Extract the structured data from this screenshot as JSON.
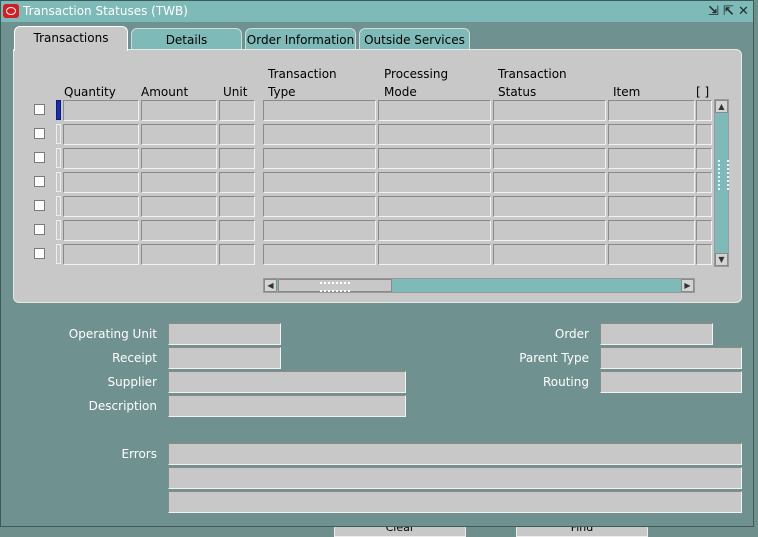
{
  "window": {
    "title": "Transaction Statuses (TWB)",
    "controls": {
      "minimize": "⇲",
      "maximize": "⇱",
      "close": "✕"
    }
  },
  "tabs": [
    {
      "label": "Transactions",
      "active": true
    },
    {
      "label": "Details",
      "active": false
    },
    {
      "label": "Order Information",
      "active": false
    },
    {
      "label": "Outside Services",
      "active": false
    }
  ],
  "grid": {
    "headers": {
      "quantity": "Quantity",
      "amount": "Amount",
      "unit": "Unit",
      "transaction_type": "Transaction Type",
      "processing_mode": "Processing Mode",
      "transaction_status": "Transaction Status",
      "item": "Item",
      "folder": "[ ]"
    },
    "row_count": 7
  },
  "form": {
    "operating_unit_label": "Operating Unit",
    "receipt_label": "Receipt",
    "supplier_label": "Supplier",
    "description_label": "Description",
    "order_label": "Order",
    "parent_type_label": "Parent Type",
    "routing_label": "Routing",
    "errors_label": "Errors"
  },
  "bottom_buttons": {
    "clear": "Clear",
    "find": "Find"
  },
  "colors": {
    "background": "#6f9290",
    "titlebar": "#7dbab8",
    "field": "#c8c8c8",
    "current_row": "#1a2bb0"
  }
}
